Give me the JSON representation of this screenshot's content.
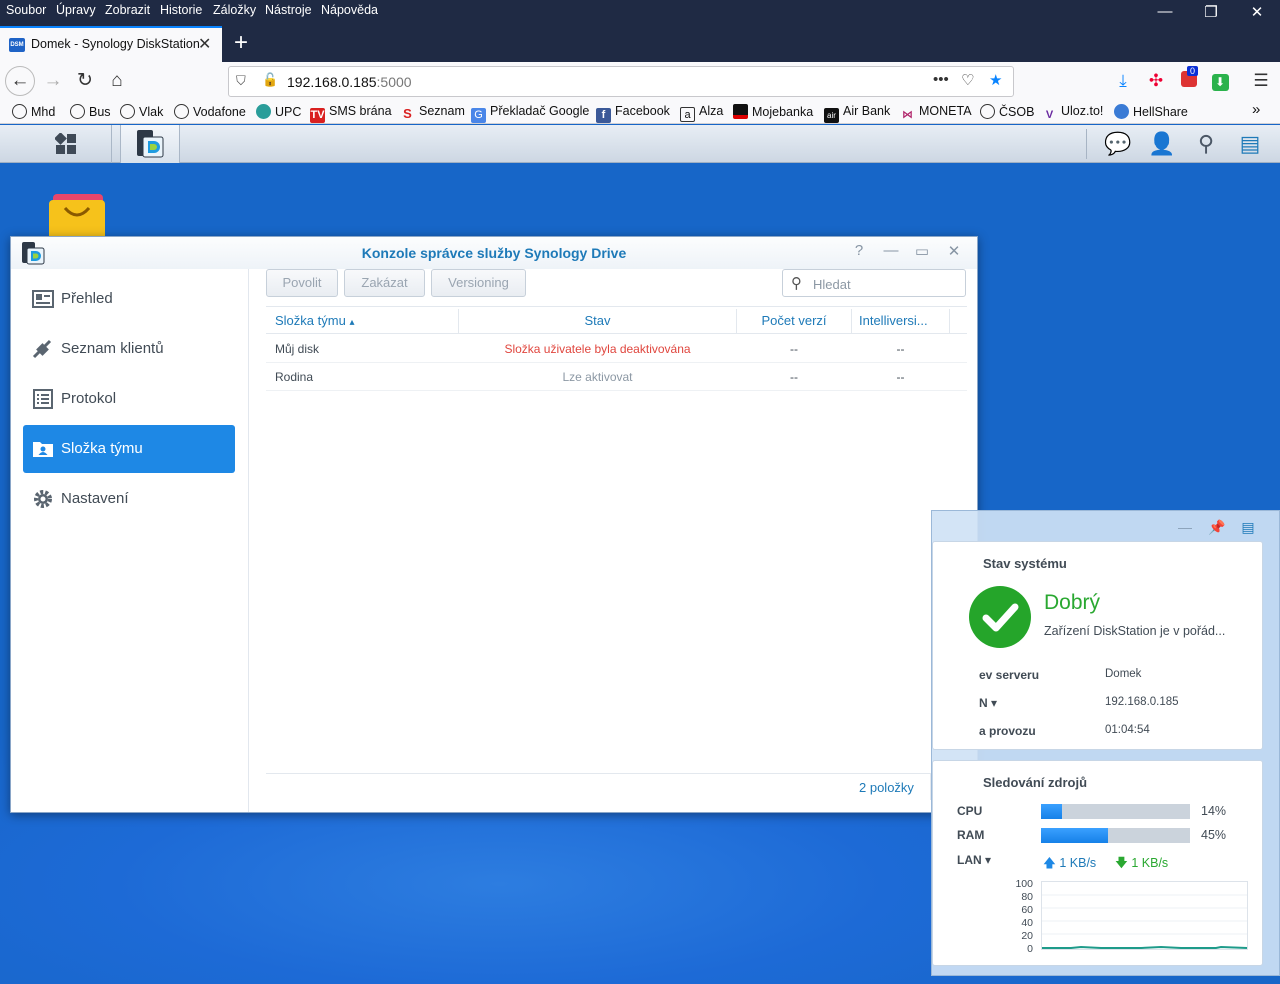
{
  "browser": {
    "menu": [
      "Soubor",
      "Úpravy",
      "Zobrazit",
      "Historie",
      "Záložky",
      "Nástroje",
      "Nápověda"
    ],
    "tab_title": "Domek - Synology DiskStation",
    "tab_favicon_text": "DSM",
    "url_host": "192.168.0.185",
    "url_port": ":5000",
    "downloads_badge": "0",
    "bookmarks": [
      "Mhd",
      "Bus",
      "Vlak",
      "Vodafone",
      "UPC",
      "SMS brána",
      "Seznam",
      "Překladač Google",
      "Facebook",
      "Alza",
      "Mojebanka",
      "Air Bank",
      "MONETA",
      "ČSOB",
      "Uloz.to!",
      "HellShare"
    ]
  },
  "window": {
    "title": "Konzole správce služby Synology Drive",
    "sidebar": [
      {
        "label": "Přehled",
        "icon": "overview-icon",
        "active": false
      },
      {
        "label": "Seznam klientů",
        "icon": "clients-icon",
        "active": false
      },
      {
        "label": "Protokol",
        "icon": "log-icon",
        "active": false
      },
      {
        "label": "Složka týmu",
        "icon": "team-folder-icon",
        "active": true
      },
      {
        "label": "Nastavení",
        "icon": "settings-icon",
        "active": false
      }
    ],
    "toolbar": {
      "enable_label": "Povolit",
      "disable_label": "Zakázat",
      "versioning_label": "Versioning",
      "search_placeholder": "Hledat"
    },
    "table": {
      "columns": [
        "Složka týmu",
        "Stav",
        "Počet verzí",
        "Intelliversi..."
      ],
      "sort_indicator": "▴",
      "rows": [
        {
          "name": "Můj disk",
          "status": "Složka uživatele byla deaktivována",
          "status_color": "#e0463e",
          "versions": "--",
          "intelli": "--"
        },
        {
          "name": "Rodina",
          "status": "Lze aktivovat",
          "status_color": "#8c98a4",
          "versions": "--",
          "intelli": "--"
        }
      ],
      "footer_count": "2 položky"
    }
  },
  "widgets": {
    "system": {
      "title": "Stav systému",
      "status": "Dobrý",
      "status_color": "#2aa831",
      "description": "Zařízení DiskStation je v pořád...",
      "rows": [
        {
          "label": "ev serveru",
          "value": "Domek"
        },
        {
          "label": "N ▾",
          "value": "192.168.0.185"
        },
        {
          "label": "a provozu",
          "value": "01:04:54"
        }
      ]
    },
    "resources": {
      "title": "Sledování zdrojů",
      "cpu_label": "CPU",
      "cpu_value": "14%",
      "cpu_fraction": 0.14,
      "ram_label": "RAM",
      "ram_value": "45%",
      "ram_fraction": 0.45,
      "lan_label": "LAN ▾",
      "lan_up": "1 KB/s",
      "lan_down": "1 KB/s",
      "chart_ticks": [
        "100",
        "80",
        "60",
        "40",
        "20",
        "0"
      ]
    }
  }
}
